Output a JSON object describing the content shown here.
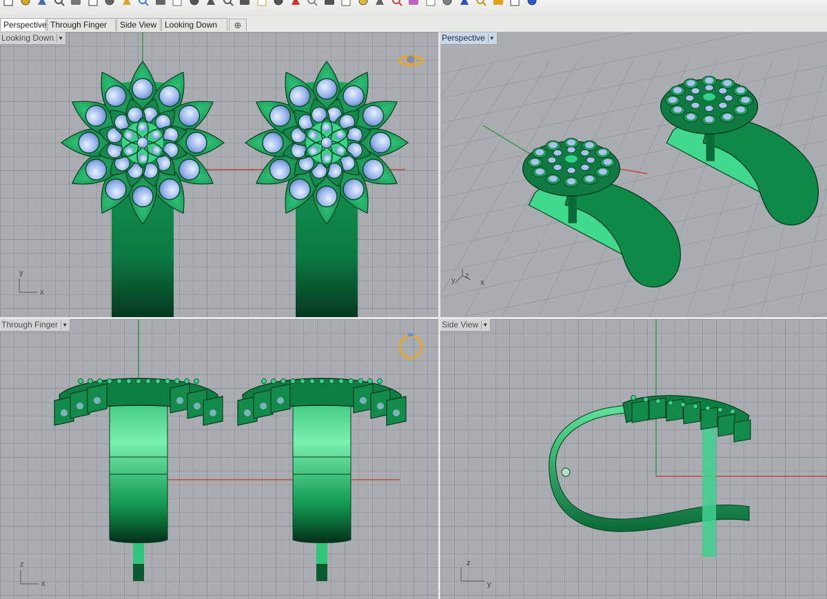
{
  "toolbar": {
    "icons": [
      "new-icon",
      "open-icon",
      "save-icon",
      "print-icon",
      "copy-doc-icon",
      "cut-icon",
      "copy-icon",
      "paste-icon",
      "undo-icon",
      "pan-icon",
      "rotate-icon",
      "zoom-icon",
      "zoom-window-icon",
      "zoom-extents-icon",
      "zoom-selected-icon",
      "zoom-target-icon",
      "grid-icon",
      "car-icon",
      "snap-icon",
      "history-icon",
      "select-icon",
      "light-icon",
      "layer-icon",
      "render-red-icon",
      "color-wheel-icon",
      "material-sphere-icon",
      "material-sphere-2-icon",
      "blue-sphere-icon",
      "pointer-icon",
      "gear-icon",
      "shrink-icon",
      "help-icon"
    ]
  },
  "tabs": [
    {
      "label": "Perspective",
      "active": true
    },
    {
      "label": "Through Finger",
      "active": false
    },
    {
      "label": "Side View",
      "active": false
    },
    {
      "label": "Looking Down",
      "active": false
    }
  ],
  "viewports": {
    "top_left": {
      "label": "Looking Down",
      "axis_v": "y",
      "axis_h": "x",
      "active": false
    },
    "top_right": {
      "label": "Perspective",
      "axis_v": "z",
      "axis_h": "x",
      "axis_extra": "y",
      "active": true
    },
    "bottom_left": {
      "label": "Through Finger",
      "axis_v": "z",
      "axis_h": "x",
      "active": false
    },
    "bottom_right": {
      "label": "Side View",
      "axis_v": "z",
      "axis_h": "y",
      "active": false
    }
  },
  "colors": {
    "model_green": "#0c8a4a",
    "gem_blue": "#a9c2f0",
    "axis_red": "#c0392b",
    "axis_green": "#2e8b3a",
    "active_label": "#c9d7ea"
  }
}
